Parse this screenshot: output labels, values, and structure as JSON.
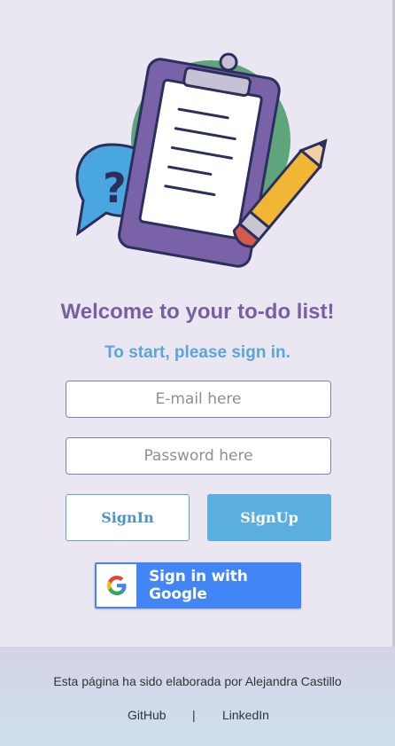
{
  "hero": {
    "icons": [
      "clipboard-icon",
      "question-bubble-icon",
      "pencil-icon"
    ]
  },
  "heading": {
    "title": "Welcome to your to-do list!",
    "subtitle": "To start, please sign in."
  },
  "form": {
    "email_placeholder": "E-mail here",
    "password_placeholder": "Password here"
  },
  "buttons": {
    "signin_label": "SignIn",
    "signup_label": "SignUp",
    "google_label": "Sign in with Google"
  },
  "footer": {
    "credit": "Esta página ha sido elaborada por Alejandra Castillo",
    "github": "GitHub",
    "separator": "|",
    "linkedin": "LinkedIn"
  },
  "colors": {
    "title": "#7a5fa0",
    "subtitle": "#5aa6d6",
    "signup_bg": "#5aaee0",
    "google_blue": "#4285f4",
    "background": "#ebe7f2"
  }
}
